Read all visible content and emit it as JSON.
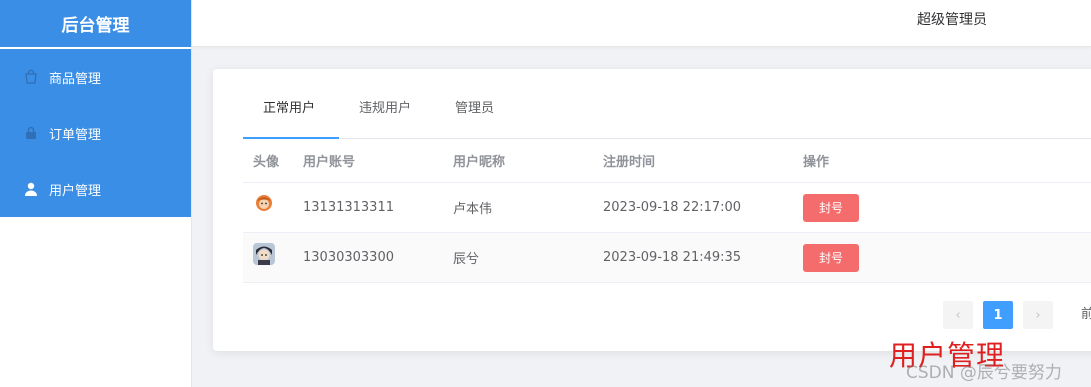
{
  "app": {
    "title": "后台管理"
  },
  "sidebar": {
    "items": [
      {
        "label": "商品管理",
        "icon": "shopping-bag-icon"
      },
      {
        "label": "订单管理",
        "icon": "lock-bag-icon"
      },
      {
        "label": "用户管理",
        "icon": "user-icon"
      }
    ]
  },
  "header": {
    "user": "超级管理员"
  },
  "tabs": [
    {
      "label": "正常用户",
      "active": true
    },
    {
      "label": "违规用户",
      "active": false
    },
    {
      "label": "管理员",
      "active": false
    }
  ],
  "table": {
    "columns": [
      "头像",
      "用户账号",
      "用户昵称",
      "注册时间",
      "操作"
    ],
    "rows": [
      {
        "avatar": "avatar-orange-icon",
        "account": "13131313311",
        "nickname": "卢本伟",
        "registered": "2023-09-18 22:17:00",
        "action": "封号"
      },
      {
        "avatar": "avatar-dark-icon",
        "account": "13030303300",
        "nickname": "辰兮",
        "registered": "2023-09-18 21:49:35",
        "action": "封号"
      }
    ]
  },
  "pagination": {
    "prev": "‹",
    "current": "1",
    "next": "›",
    "trailing": "前"
  },
  "watermark": {
    "title": "用户管理",
    "csdn": "CSDN @辰兮要努力"
  },
  "colors": {
    "primary": "#409eff",
    "sidebar": "#3a8ee6",
    "danger": "#f56c6c",
    "watermark_title": "#e02020"
  }
}
